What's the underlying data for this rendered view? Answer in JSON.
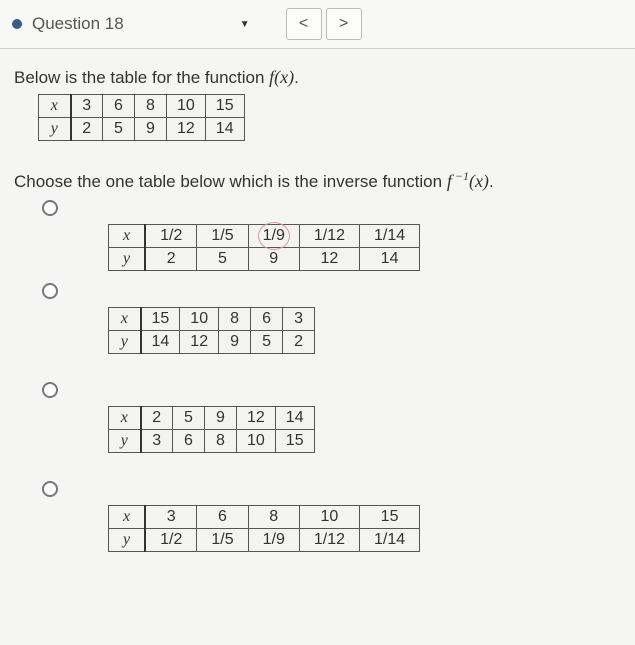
{
  "header": {
    "title": "Question 18",
    "prev_icon": "<",
    "next_icon": ">"
  },
  "prompt1_pre": "Below is the table for the function ",
  "prompt1_fn": "f(x)",
  "prompt1_post": ".",
  "fx_table": {
    "row_x_label": "x",
    "row_y_label": "y",
    "x": [
      "3",
      "6",
      "8",
      "10",
      "15"
    ],
    "y": [
      "2",
      "5",
      "9",
      "12",
      "14"
    ]
  },
  "prompt2_pre": "Choose the one table below which is the inverse function ",
  "prompt2_fn": "f",
  "prompt2_exp": " −1",
  "prompt2_arg": "(x)",
  "prompt2_post": ".",
  "options": [
    {
      "x": [
        "1/2",
        "1/5",
        "1/9",
        "1/12",
        "1/14"
      ],
      "y": [
        "2",
        "5",
        "9",
        "12",
        "14"
      ],
      "circled_col": 2,
      "wide": true
    },
    {
      "x": [
        "15",
        "10",
        "8",
        "6",
        "3"
      ],
      "y": [
        "14",
        "12",
        "9",
        "5",
        "2"
      ]
    },
    {
      "x": [
        "2",
        "5",
        "9",
        "12",
        "14"
      ],
      "y": [
        "3",
        "6",
        "8",
        "10",
        "15"
      ]
    },
    {
      "x": [
        "3",
        "6",
        "8",
        "10",
        "15"
      ],
      "y": [
        "1/2",
        "1/5",
        "1/9",
        "1/12",
        "1/14"
      ],
      "wide": true
    }
  ],
  "row_x_label": "x",
  "row_y_label": "y"
}
